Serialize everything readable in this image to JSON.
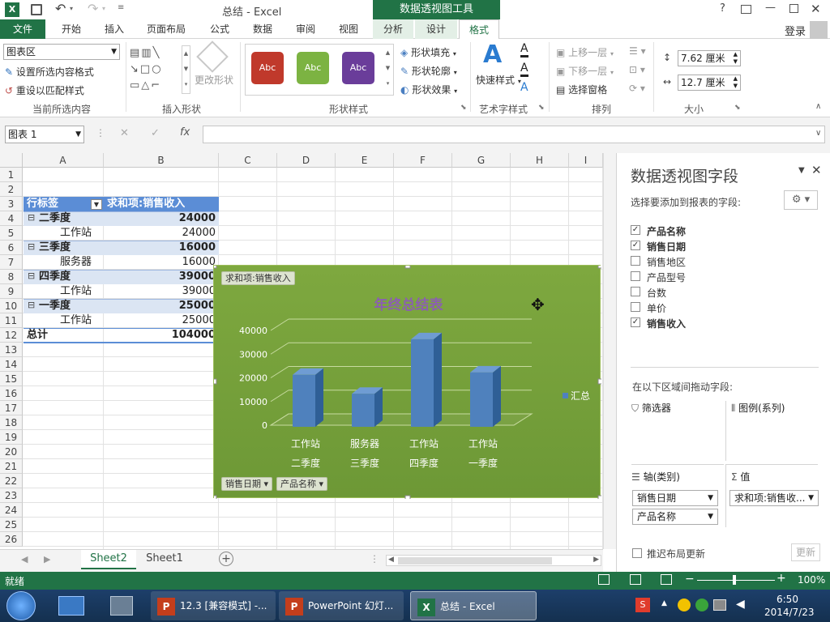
{
  "app": {
    "title": "总结 - Excel",
    "contextual_group": "数据透视图工具",
    "signin": "登录"
  },
  "tabs": [
    "文件",
    "开始",
    "插入",
    "页面布局",
    "公式",
    "数据",
    "审阅",
    "视图",
    "分析",
    "设计",
    "格式"
  ],
  "ribbon": {
    "current_selection": {
      "dropdown_value": "图表区",
      "format_selection": "设置所选内容格式",
      "reset_style": "重设以匹配样式",
      "group_label": "当前所选内容"
    },
    "insert_shapes": {
      "change_shape": "更改形状",
      "group_label": "插入形状"
    },
    "shape_styles": {
      "swatch_text": "Abc",
      "fill": "形状填充",
      "outline": "形状轮廓",
      "effects": "形状效果",
      "group_label": "形状样式",
      "swatch_colors": [
        "#c0392b",
        "#7cb342",
        "#6a3d9a"
      ]
    },
    "wordart": {
      "quick_styles": "快速样式",
      "group_label": "艺术字样式",
      "glyph": "A"
    },
    "arrange": {
      "bring_forward": "上移一层",
      "send_backward": "下移一层",
      "selection_pane": "选择窗格",
      "group_label": "排列"
    },
    "size": {
      "height": "7.62 厘米",
      "width": "12.7 厘米",
      "group_label": "大小"
    }
  },
  "formula_bar": {
    "name_box": "图表 1",
    "fx": "fx"
  },
  "columns": [
    "A",
    "B",
    "C",
    "D",
    "E",
    "F",
    "G",
    "H",
    "I"
  ],
  "rows": [
    "1",
    "2",
    "3",
    "4",
    "5",
    "6",
    "7",
    "8",
    "9",
    "10",
    "11",
    "12",
    "13",
    "14",
    "15",
    "16",
    "17",
    "18",
    "19",
    "20",
    "21",
    "22",
    "23",
    "24",
    "25",
    "26"
  ],
  "pivot": {
    "header_row_label": "行标签",
    "header_value": "求和项:销售收入",
    "rows": [
      {
        "label": "二季度",
        "value": "24000",
        "bold": true
      },
      {
        "label": "工作站",
        "value": "24000",
        "bold": false
      },
      {
        "label": "三季度",
        "value": "16000",
        "bold": true
      },
      {
        "label": "服务器",
        "value": "16000",
        "bold": false
      },
      {
        "label": "四季度",
        "value": "39000",
        "bold": true
      },
      {
        "label": "工作站",
        "value": "39000",
        "bold": false
      },
      {
        "label": "一季度",
        "value": "25000",
        "bold": true
      },
      {
        "label": "工作站",
        "value": "25000",
        "bold": false
      }
    ],
    "total_label": "总计",
    "total_value": "104000"
  },
  "chart_data": {
    "type": "bar",
    "title": "年终总结表",
    "value_field_button": "求和项:销售收入",
    "axis_field_buttons": [
      "销售日期",
      "产品名称"
    ],
    "categories": [
      {
        "product": "工作站",
        "quarter": "二季度"
      },
      {
        "product": "服务器",
        "quarter": "三季度"
      },
      {
        "product": "工作站",
        "quarter": "四季度"
      },
      {
        "product": "工作站",
        "quarter": "一季度"
      }
    ],
    "series": [
      {
        "name": "汇总",
        "values": [
          24000,
          16000,
          39000,
          25000
        ],
        "color": "#4f81bd"
      }
    ],
    "yticks": [
      "0",
      "10000",
      "20000",
      "30000",
      "40000"
    ],
    "ylim": [
      0,
      40000
    ],
    "grid": true,
    "legend": "right",
    "bar_3d": true
  },
  "sheets": [
    "Sheet2",
    "Sheet1"
  ],
  "active_sheet": "Sheet2",
  "status": {
    "ready": "就绪",
    "zoom": "100%"
  },
  "pane": {
    "title": "数据透视图字段",
    "subtitle": "选择要添加到报表的字段:",
    "fields": [
      {
        "name": "产品名称",
        "checked": true
      },
      {
        "name": "销售日期",
        "checked": true
      },
      {
        "name": "销售地区",
        "checked": false
      },
      {
        "name": "产品型号",
        "checked": false
      },
      {
        "name": "台数",
        "checked": false
      },
      {
        "name": "单价",
        "checked": false
      },
      {
        "name": "销售收入",
        "checked": true
      }
    ],
    "drag_hint": "在以下区域间拖动字段:",
    "areas": {
      "filter": "筛选器",
      "legend": "图例(系列)",
      "axis": "轴(类别)",
      "values": "值",
      "axis_items": [
        "销售日期",
        "产品名称"
      ],
      "value_items": [
        "求和项:销售收..."
      ]
    },
    "defer_label": "推迟布局更新",
    "update_button": "更新"
  },
  "taskbar": {
    "items": [
      "12.3 [兼容模式] -...",
      "PowerPoint 幻灯...",
      "总结 - Excel"
    ],
    "time": "6:50",
    "date": "2014/7/23"
  }
}
